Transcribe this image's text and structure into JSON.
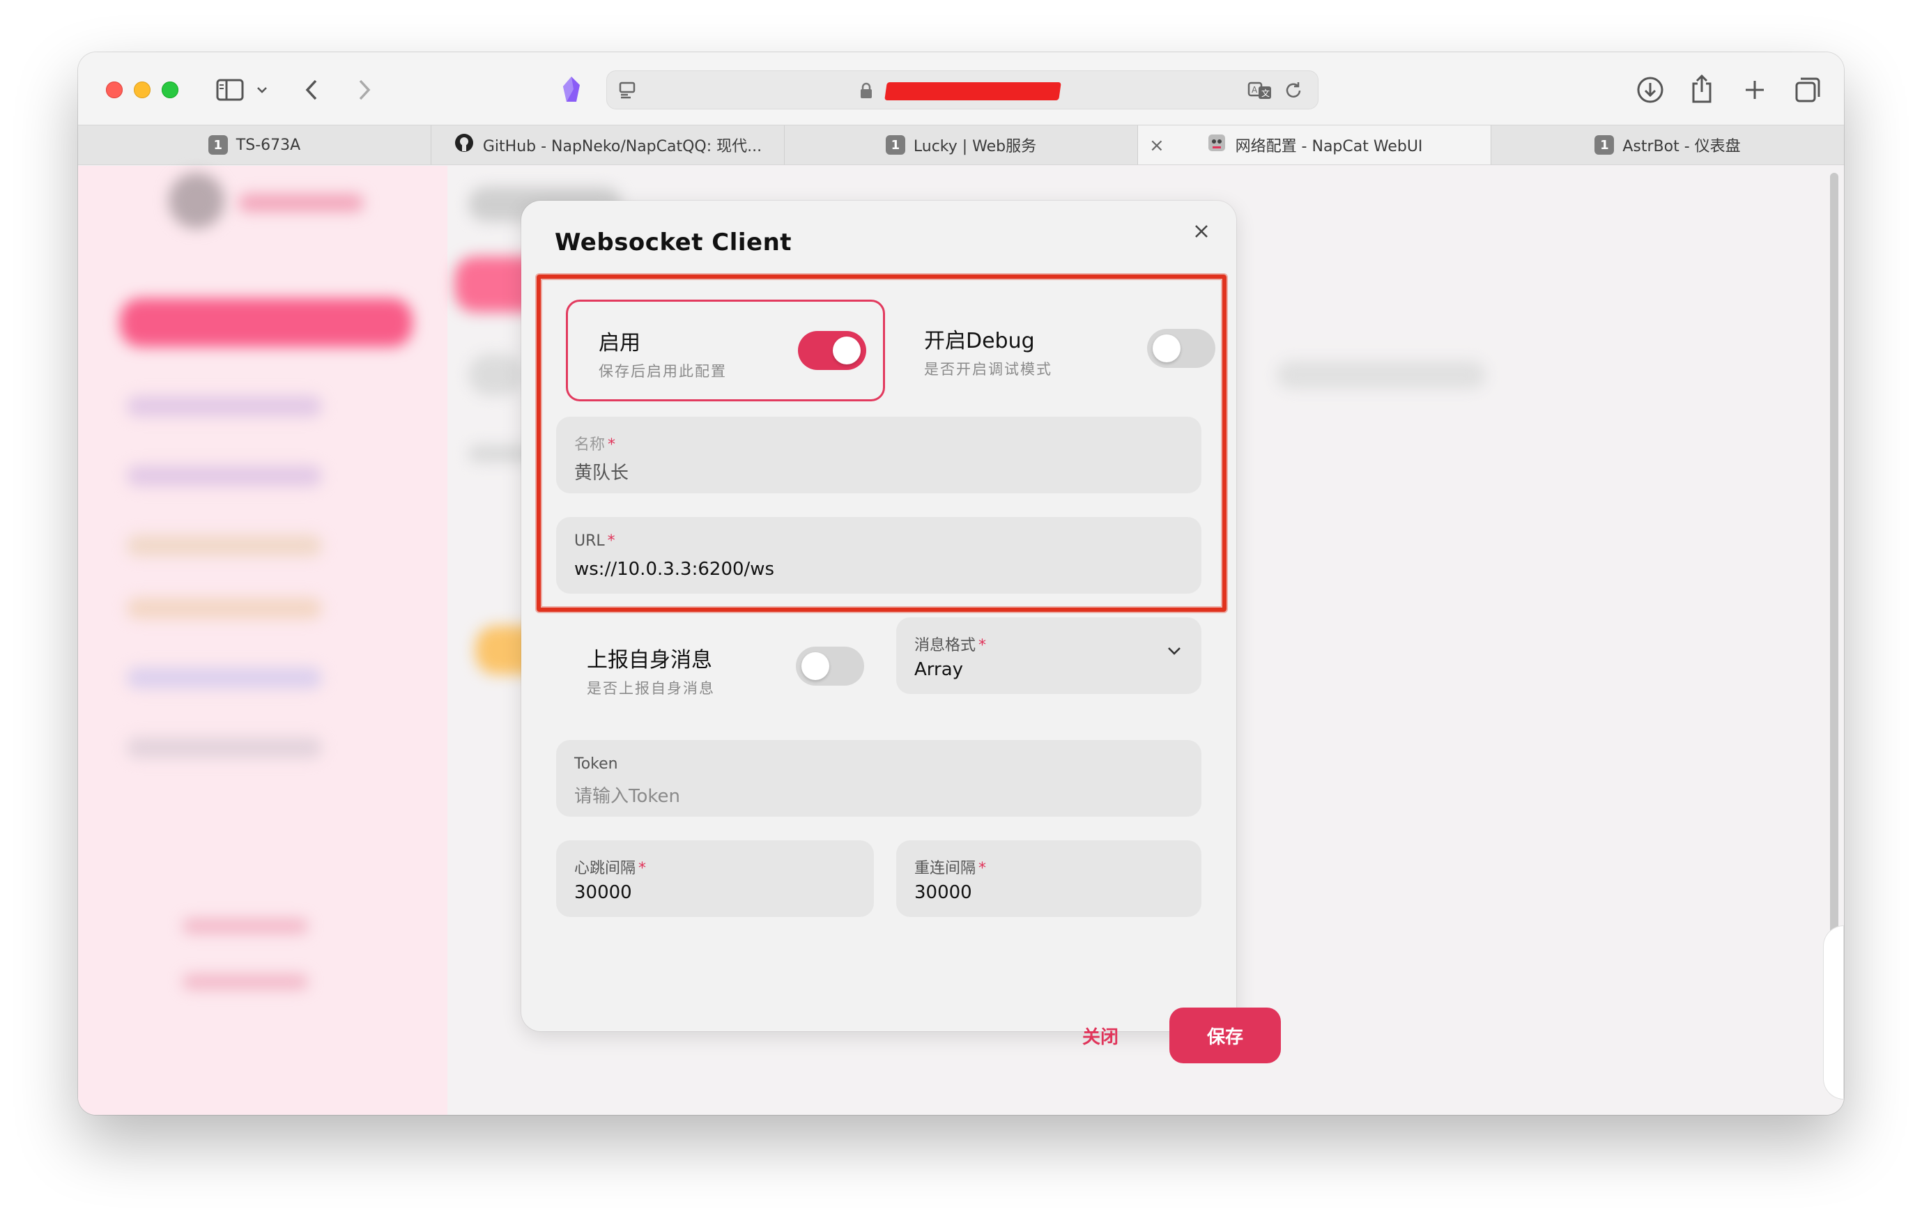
{
  "browser": {
    "tabs": [
      {
        "badge": "1",
        "label": "TS-673A"
      },
      {
        "badge": "",
        "label": "GitHub - NapNeko/NapCatQQ: 现代..."
      },
      {
        "badge": "1",
        "label": "Lucky | Web服务"
      },
      {
        "badge": "",
        "label": "网络配置 - NapCat WebUI"
      },
      {
        "badge": "1",
        "label": "AstrBot - 仪表盘"
      }
    ],
    "tab_close_glyph": "×",
    "colors": {
      "accent": "#e0345a",
      "highlight_frame": "#e0321e"
    }
  },
  "modal": {
    "title": "Websocket Client",
    "close_glyph": "×",
    "enable": {
      "title": "启用",
      "desc": "保存后启用此配置",
      "state": "on"
    },
    "debug": {
      "title": "开启Debug",
      "desc": "是否开启调试模式",
      "state": "off"
    },
    "name_field": {
      "label": "名称",
      "required": "*",
      "value": "黄队长"
    },
    "url_field": {
      "label": "URL",
      "required": "*",
      "value": "ws://10.0.3.3:6200/ws"
    },
    "report_self": {
      "title": "上报自身消息",
      "desc": "是否上报自身消息",
      "state": "off"
    },
    "message_format": {
      "label": "消息格式",
      "required": "*",
      "value": "Array"
    },
    "token_field": {
      "label": "Token",
      "placeholder": "请输入Token"
    },
    "heartbeat_field": {
      "label": "心跳间隔",
      "required": "*",
      "value": "30000"
    },
    "reconnect_field": {
      "label": "重连间隔",
      "required": "*",
      "value": "30000"
    },
    "buttons": {
      "close": "关闭",
      "save": "保存"
    }
  }
}
